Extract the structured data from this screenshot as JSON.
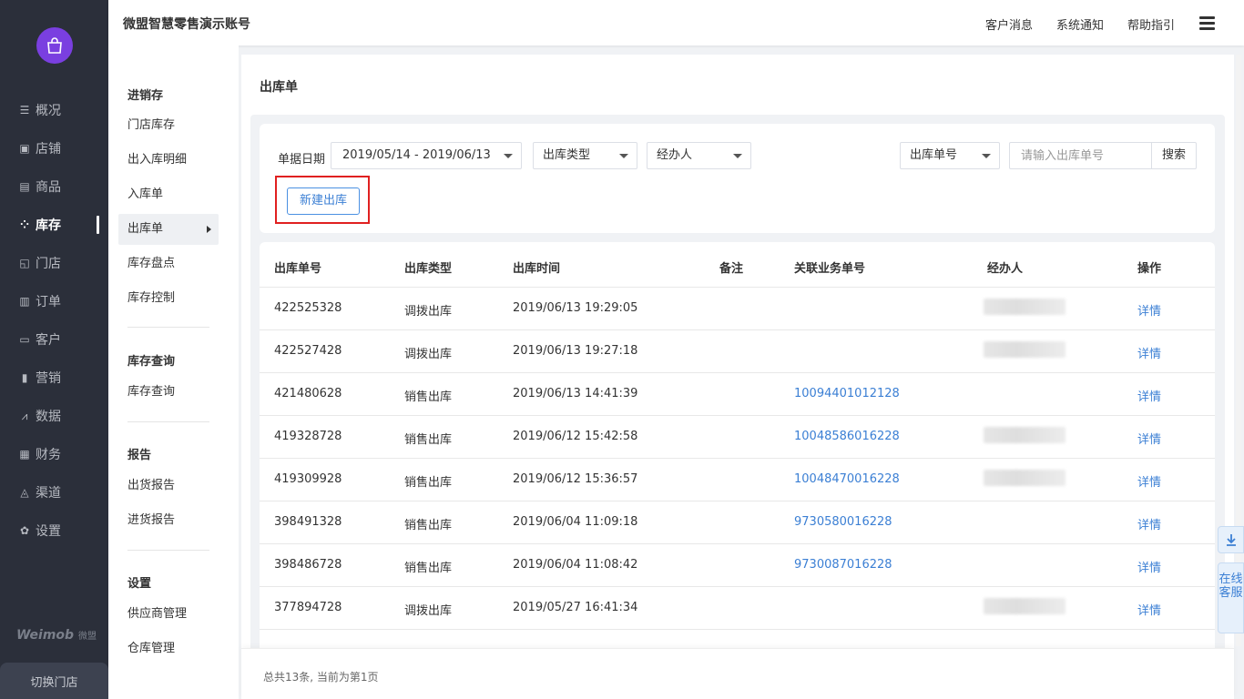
{
  "app": {
    "store_title": "微盟智慧零售演示账号"
  },
  "topbar": {
    "links": [
      "客户消息",
      "系统通知",
      "帮助指引"
    ]
  },
  "leftnav": {
    "items": [
      {
        "label": "概况",
        "icon": "☰"
      },
      {
        "label": "店铺",
        "icon": "▣"
      },
      {
        "label": "商品",
        "icon": "▤"
      },
      {
        "label": "库存",
        "icon": "⁘"
      },
      {
        "label": "门店",
        "icon": "◱"
      },
      {
        "label": "订单",
        "icon": "▥"
      },
      {
        "label": "客户",
        "icon": "▭"
      },
      {
        "label": "营销",
        "icon": "▮"
      },
      {
        "label": "数据",
        "icon": "⩘"
      },
      {
        "label": "财务",
        "icon": "▦"
      },
      {
        "label": "渠道",
        "icon": "◬"
      },
      {
        "label": "设置",
        "icon": "✿"
      }
    ],
    "active_index": 3,
    "brand": "Weimob",
    "brand_cn": "微盟",
    "switch_store": "切换门店"
  },
  "subnav": {
    "sections": [
      {
        "title": "进销存",
        "items": [
          "门店库存",
          "出入库明细",
          "入库单",
          "出库单",
          "库存盘点",
          "库存控制"
        ]
      },
      {
        "title": "库存查询",
        "items": [
          "库存查询"
        ]
      },
      {
        "title": "报告",
        "items": [
          "出货报告",
          "进货报告"
        ]
      },
      {
        "title": "设置",
        "items": [
          "供应商管理",
          "仓库管理"
        ]
      }
    ],
    "active_item": "出库单"
  },
  "page": {
    "title": "出库单",
    "filters": {
      "date_label": "单据日期",
      "date_range": "2019/05/14 - 2019/06/13",
      "type_select": "出库类型",
      "handler_select": "经办人",
      "search_field_select": "出库单号",
      "search_placeholder": "请输入出库单号",
      "search_button": "搜索"
    },
    "new_button": "新建出库"
  },
  "table": {
    "columns": [
      "出库单号",
      "出库类型",
      "出库时间",
      "备注",
      "关联业务单号",
      "经办人",
      "操作"
    ],
    "rows": [
      {
        "id": "422525328",
        "type": "调拨出库",
        "time": "2019/06/13 19:29:05",
        "note": "",
        "ref": "",
        "action": "详情"
      },
      {
        "id": "422527428",
        "type": "调拨出库",
        "time": "2019/06/13 19:27:18",
        "note": "",
        "ref": "",
        "action": "详情"
      },
      {
        "id": "421480628",
        "type": "销售出库",
        "time": "2019/06/13 14:41:39",
        "note": "",
        "ref": "10094401012128",
        "action": "详情"
      },
      {
        "id": "419328728",
        "type": "销售出库",
        "time": "2019/06/12 15:42:58",
        "note": "",
        "ref": "10048586016228",
        "action": "详情"
      },
      {
        "id": "419309928",
        "type": "销售出库",
        "time": "2019/06/12 15:36:57",
        "note": "",
        "ref": "10048470016228",
        "action": "详情"
      },
      {
        "id": "398491328",
        "type": "销售出库",
        "time": "2019/06/04 11:09:18",
        "note": "",
        "ref": "9730580016228",
        "action": "详情"
      },
      {
        "id": "398486728",
        "type": "销售出库",
        "time": "2019/06/04 11:08:42",
        "note": "",
        "ref": "9730087016228",
        "action": "详情"
      },
      {
        "id": "377894728",
        "type": "调拨出库",
        "time": "2019/05/27 16:41:34",
        "note": "",
        "ref": "",
        "action": "详情"
      }
    ]
  },
  "footer": {
    "summary": "总共13条, 当前为第1页"
  },
  "float": {
    "customer_service": "在线客服"
  }
}
